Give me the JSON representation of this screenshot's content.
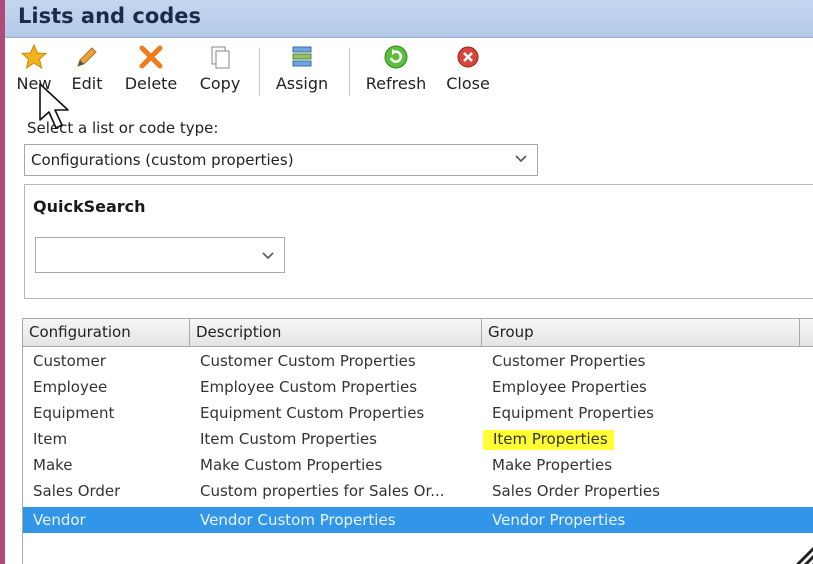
{
  "window": {
    "title": "Lists and codes"
  },
  "toolbar": {
    "new_label": "New",
    "edit_label": "Edit",
    "delete_label": "Delete",
    "copy_label": "Copy",
    "assign_label": "Assign",
    "refresh_label": "Refresh",
    "close_label": "Close"
  },
  "list_type": {
    "label": "Select a list or code type:",
    "selected": "Configurations (custom properties)"
  },
  "quicksearch": {
    "title": "QuickSearch",
    "value": ""
  },
  "grid": {
    "columns": [
      "Configuration",
      "Description",
      "Group"
    ],
    "rows": [
      {
        "configuration": "Customer",
        "description": "Customer Custom Properties",
        "group": "Customer Properties"
      },
      {
        "configuration": "Employee",
        "description": "Employee Custom Properties",
        "group": "Employee Properties"
      },
      {
        "configuration": "Equipment",
        "description": "Equipment Custom Properties",
        "group": "Equipment Properties"
      },
      {
        "configuration": "Item",
        "description": "Item Custom Properties",
        "group": "Item Properties"
      },
      {
        "configuration": "Make",
        "description": "Make Custom Properties",
        "group": "Make Properties"
      },
      {
        "configuration": "Sales Order",
        "description": "Custom properties for Sales Or...",
        "group": "Sales Order Properties"
      },
      {
        "configuration": "Vendor",
        "description": "Vendor Custom Properties",
        "group": "Vendor Properties"
      }
    ],
    "selected_row": "Vendor",
    "highlighted_cell": "Item Properties"
  },
  "colors": {
    "title_bar": "#b9cdea",
    "selection": "#3296e8",
    "highlight": "#ffff33",
    "window_border": "#b04a7a"
  },
  "icons": [
    "star-icon",
    "pencil-icon",
    "delete-x-icon",
    "copy-icon",
    "assign-icon",
    "refresh-icon",
    "close-icon",
    "chevron-down-icon",
    "mouse-cursor-icon",
    "resize-grip-icon"
  ]
}
